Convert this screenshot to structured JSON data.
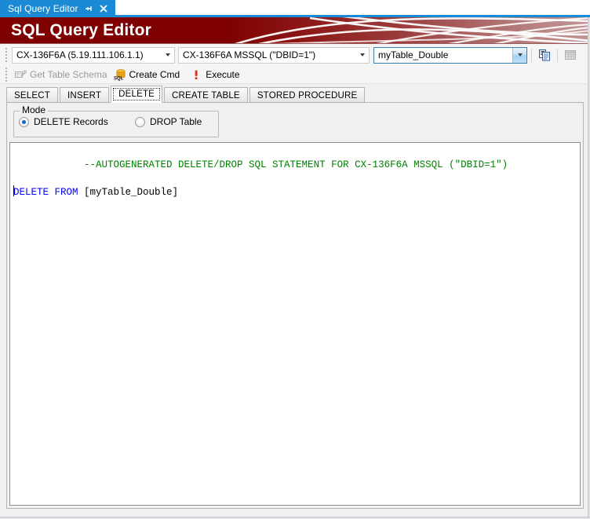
{
  "window": {
    "doc_tab": {
      "title": "Sql Query Editor",
      "pin_icon": "pin-icon",
      "close_icon": "close-icon"
    },
    "banner_title": "SQL Query Editor"
  },
  "toolbar_top": {
    "connection_combo": {
      "value": "CX-136F6A (5.19.111.106.1.1)"
    },
    "database_combo": {
      "value": "CX-136F6A MSSQL (\"DBID=1\")"
    },
    "table_combo": {
      "value": "myTable_Double"
    },
    "copy_button": {
      "icon": "copy-documents-icon"
    },
    "grid_button": {
      "icon": "table-grid-icon"
    }
  },
  "toolbar_commands": {
    "get_table_schema": {
      "label": "Get Table Schema",
      "icon": "table-schema-icon",
      "enabled": false
    },
    "create_cmd": {
      "label": "Create Cmd",
      "icon": "sql-database-icon",
      "enabled": true
    },
    "execute": {
      "label": "Execute",
      "icon": "execute-exclamation-icon",
      "enabled": true
    }
  },
  "tabs": [
    {
      "label": "SELECT",
      "selected": false
    },
    {
      "label": "INSERT",
      "selected": false
    },
    {
      "label": "DELETE",
      "selected": true
    },
    {
      "label": "CREATE TABLE",
      "selected": false
    },
    {
      "label": "STORED PROCEDURE",
      "selected": false
    }
  ],
  "mode_group": {
    "legend": "Mode",
    "options": [
      {
        "label": "DELETE Records",
        "checked": true
      },
      {
        "label": "DROP Table",
        "checked": false
      }
    ]
  },
  "sql_editor": {
    "lines": [
      {
        "tokens": [
          {
            "text": "--AUTOGENERATED DELETE/DROP SQL STATEMENT FOR CX-136F6A MSSQL (\"DBID=1\")",
            "type": "comment"
          }
        ]
      },
      {
        "tokens": [
          {
            "text": "DELETE FROM ",
            "type": "keyword"
          },
          {
            "text": "[myTable_Double]",
            "type": "plain"
          }
        ]
      }
    ]
  },
  "colors": {
    "tab_blue": "#1a8ad4",
    "banner_red": "#7e0000",
    "comment_green": "#008000",
    "keyword_blue": "#0000ff",
    "radio_accent": "#1969c4"
  }
}
